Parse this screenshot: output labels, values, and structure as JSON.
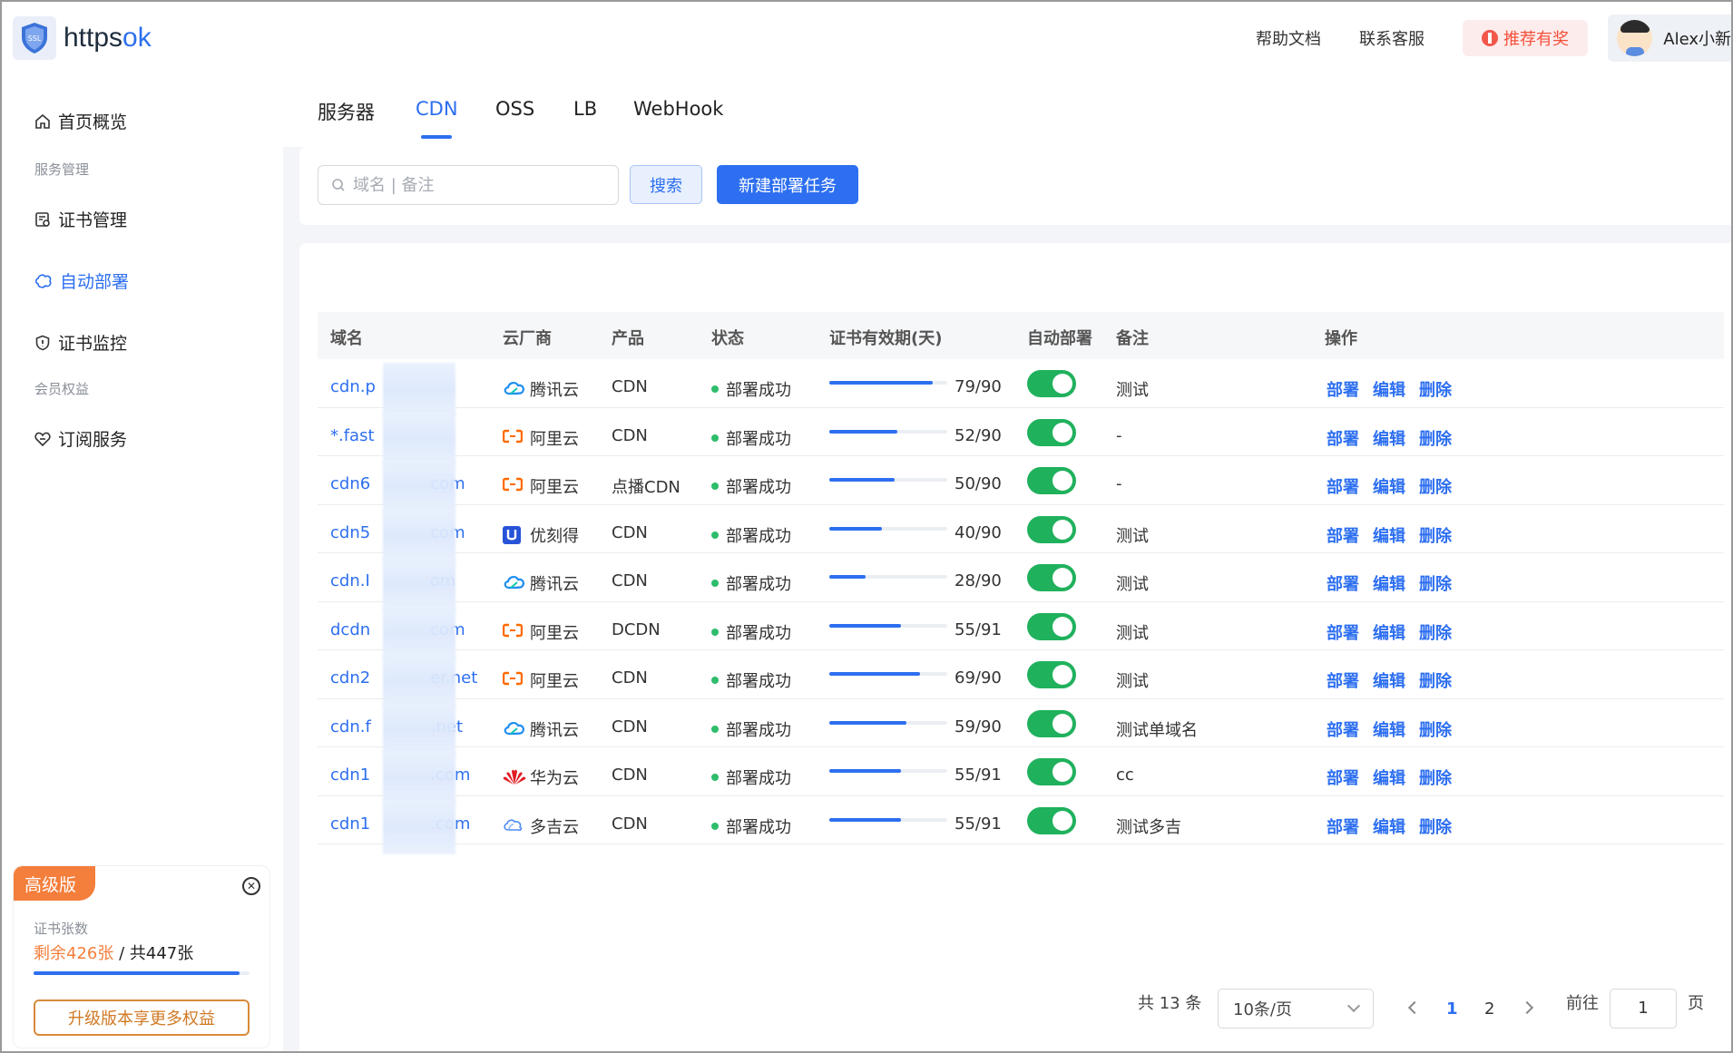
{
  "header": {
    "logo_text_main": "https",
    "logo_text_accent": "ok",
    "logo_badge": "SSL",
    "links": [
      "帮助文档",
      "联系客服"
    ],
    "promo": "推荐有奖",
    "user_name": "Alex小新"
  },
  "sidebar": {
    "items": [
      {
        "label": "首页概览",
        "icon": "home-icon"
      },
      {
        "group": "服务管理"
      },
      {
        "label": "证书管理",
        "icon": "certificate-icon"
      },
      {
        "label": "自动部署",
        "icon": "deploy-icon",
        "active": true
      },
      {
        "label": "证书监控",
        "icon": "shield-icon"
      },
      {
        "group": "会员权益"
      },
      {
        "label": "订阅服务",
        "icon": "subscribe-icon"
      }
    ],
    "card": {
      "tag": "高级版",
      "label": "证书张数",
      "remaining": "剩余426张",
      "total": " / 共447张",
      "usage_fraction": 0.953,
      "upgrade": "升级版本享更多权益"
    }
  },
  "tabs": [
    "服务器",
    "CDN",
    "OSS",
    "LB",
    "WebHook"
  ],
  "active_tab": "CDN",
  "search": {
    "placeholder": "域名 | 备注",
    "search_button": "搜索",
    "new_button": "新建部署任务"
  },
  "table": {
    "columns": [
      "域名",
      "云厂商",
      "产品",
      "状态",
      "证书有效期(天)",
      "自动部署",
      "备注",
      "操作"
    ],
    "rows": [
      {
        "prefix": "cdn.p",
        "suffix": "",
        "vendor": "腾讯云",
        "vendor_icon": "tencent-cloud-icon",
        "product": "CDN",
        "status": "部署成功",
        "days": 79,
        "max": 90,
        "validity": "79/90",
        "auto": true,
        "remark": "测试"
      },
      {
        "prefix": "*.fast",
        "suffix": "",
        "vendor": "阿里云",
        "vendor_icon": "aliyun-icon",
        "product": "CDN",
        "status": "部署成功",
        "days": 52,
        "max": 90,
        "validity": "52/90",
        "auto": true,
        "remark": "-"
      },
      {
        "prefix": "cdn6",
        "suffix": "com",
        "vendor": "阿里云",
        "vendor_icon": "aliyun-icon",
        "product": "点播CDN",
        "status": "部署成功",
        "days": 50,
        "max": 90,
        "validity": "50/90",
        "auto": true,
        "remark": "-"
      },
      {
        "prefix": "cdn5",
        "suffix": "com",
        "vendor": "优刻得",
        "vendor_icon": "ucloud-icon",
        "product": "CDN",
        "status": "部署成功",
        "days": 40,
        "max": 90,
        "validity": "40/90",
        "auto": true,
        "remark": "测试"
      },
      {
        "prefix": "cdn.I",
        "suffix": "om",
        "vendor": "腾讯云",
        "vendor_icon": "tencent-cloud-icon",
        "product": "CDN",
        "status": "部署成功",
        "days": 28,
        "max": 90,
        "validity": "28/90",
        "auto": true,
        "remark": "测试"
      },
      {
        "prefix": "dcdn",
        "suffix": "com",
        "vendor": "阿里云",
        "vendor_icon": "aliyun-icon",
        "product": "DCDN",
        "status": "部署成功",
        "days": 55,
        "max": 91,
        "validity": "55/91",
        "auto": true,
        "remark": "测试"
      },
      {
        "prefix": "cdn2",
        "suffix": "er.net",
        "vendor": "阿里云",
        "vendor_icon": "aliyun-icon",
        "product": "CDN",
        "status": "部署成功",
        "days": 69,
        "max": 90,
        "validity": "69/90",
        "auto": true,
        "remark": "测试"
      },
      {
        "prefix": "cdn.f",
        "suffix": ".net",
        "vendor": "腾讯云",
        "vendor_icon": "tencent-cloud-icon",
        "product": "CDN",
        "status": "部署成功",
        "days": 59,
        "max": 90,
        "validity": "59/90",
        "auto": true,
        "remark": "测试单域名"
      },
      {
        "prefix": "cdn1",
        "suffix": ".com",
        "vendor": "华为云",
        "vendor_icon": "huawei-cloud-icon",
        "product": "CDN",
        "status": "部署成功",
        "days": 55,
        "max": 91,
        "validity": "55/91",
        "auto": true,
        "remark": "cc"
      },
      {
        "prefix": "cdn1",
        "suffix": ".com",
        "vendor": "多吉云",
        "vendor_icon": "dogecloud-icon",
        "product": "CDN",
        "status": "部署成功",
        "days": 55,
        "max": 91,
        "validity": "55/91",
        "auto": true,
        "remark": "测试多吉"
      }
    ],
    "actions": [
      "部署",
      "编辑",
      "删除"
    ]
  },
  "pagination": {
    "total_text": "共 13 条",
    "page_size": "10条/页",
    "pages": [
      "1",
      "2"
    ],
    "current": "1",
    "goto_label": "前往",
    "goto_value": "1",
    "page_unit": "页"
  },
  "colors": {
    "accent": "#2d6ff0",
    "success": "#2ebd6b",
    "toggle_on": "#20b15d",
    "promo": "#f5503a",
    "tag": "#f47e3b"
  }
}
